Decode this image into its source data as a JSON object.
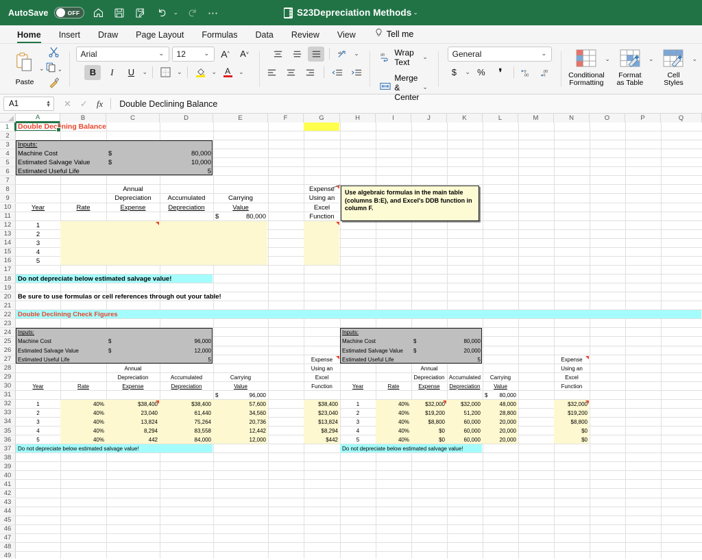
{
  "titlebar": {
    "autosave_label": "AutoSave",
    "autosave_state": "OFF",
    "document_title": "S23Depreciation Methods",
    "icons": [
      "home-icon",
      "save-icon",
      "save-as-icon",
      "undo-icon",
      "redo-icon",
      "more-icon"
    ]
  },
  "tabs": [
    {
      "label": "Home",
      "active": true
    },
    {
      "label": "Insert",
      "active": false
    },
    {
      "label": "Draw",
      "active": false
    },
    {
      "label": "Page Layout",
      "active": false
    },
    {
      "label": "Formulas",
      "active": false
    },
    {
      "label": "Data",
      "active": false
    },
    {
      "label": "Review",
      "active": false
    },
    {
      "label": "View",
      "active": false
    }
  ],
  "tell_me": "Tell me",
  "ribbon": {
    "paste_label": "Paste",
    "font_name": "Arial",
    "font_size": "12",
    "bold": "B",
    "italic": "I",
    "underline": "U",
    "wrap_text": "Wrap Text",
    "merge_center": "Merge & Center",
    "number_format": "General",
    "conditional_formatting": "Conditional\nFormatting",
    "conditional_formatting_l1": "Conditional",
    "conditional_formatting_l2": "Formatting",
    "format_as_table_l1": "Format",
    "format_as_table_l2": "as Table",
    "cell_styles_l1": "Cell",
    "cell_styles_l2": "Styles",
    "percent": "%",
    "comma": "❛",
    "currency": "$"
  },
  "formula_bar": {
    "name_box": "A1",
    "content": "Double Declining Balance",
    "cancel_icon": "cancel-icon",
    "confirm_icon": "confirm-icon",
    "fx_icon": "fx-icon"
  },
  "grid": {
    "columns": [
      "A",
      "B",
      "C",
      "D",
      "E",
      "F",
      "G",
      "H",
      "I",
      "J",
      "K",
      "L",
      "M",
      "N",
      "O",
      "P",
      "Q"
    ],
    "selected_column": "A",
    "selected_row": 1,
    "first_row": 1,
    "last_row": 49
  },
  "comment": {
    "text": "Use algebraic formulas in the main table (columns B:E), and Excel's DDB function in column F."
  },
  "main_table": {
    "title": "Double Declining Balance",
    "inputs_label": "Inputs:",
    "machine_cost_label": "Machine Cost",
    "machine_cost_sym": "$",
    "machine_cost_value": "80,000",
    "salvage_label": "Estimated Salvage Value",
    "salvage_sym": "$",
    "salvage_value": "10,000",
    "life_label": "Estimated Useful Life",
    "life_value": "5",
    "headers": {
      "year": "Year",
      "rate": "Rate",
      "annual": "Annual",
      "depreciation": "Depreciation",
      "expense": "Expense",
      "accumulated": "Accumulated",
      "accum_depreciation": "Depreciation",
      "carrying": "Carrying",
      "value": "Value",
      "fn_l1": "Expense",
      "fn_l2": "Using an",
      "fn_l3": "Excel",
      "fn_l4": "Function"
    },
    "start_sym": "$",
    "start_value": "80,000",
    "years": [
      "1",
      "2",
      "3",
      "4",
      "5"
    ],
    "note_salvage": "Do not depreciate below estimated salvage value!",
    "note_formulas": "Be sure to use formulas or cell references through out your table!"
  },
  "check_banner": "Double Declining Check Figures",
  "check_left": {
    "inputs_label": "Inputs:",
    "machine_cost_label": "Machine Cost",
    "machine_cost_sym": "$",
    "machine_cost_value": "96,000",
    "salvage_label": "Estimated Salvage Value",
    "salvage_sym": "$",
    "salvage_value": "12,000",
    "life_label": "Estimated Useful Life",
    "life_value": "5",
    "headers": {
      "year": "Year",
      "rate": "Rate",
      "annual": "Annual",
      "depreciation": "Depreciation",
      "expense": "Expense",
      "accumulated": "Accumulated",
      "accum_depreciation": "Depreciation",
      "carrying": "Carrying",
      "value": "Value",
      "fn_l1": "Expense",
      "fn_l2": "Using an",
      "fn_l3": "Excel",
      "fn_l4": "Function"
    },
    "start_sym": "$",
    "start_value": "96,000",
    "rows": [
      {
        "year": "1",
        "rate": "40%",
        "expense": "$38,400",
        "accumulated": "$38,400",
        "carrying": "57,600",
        "fn": "$38,400"
      },
      {
        "year": "2",
        "rate": "40%",
        "expense": "23,040",
        "accumulated": "61,440",
        "carrying": "34,560",
        "fn": "$23,040"
      },
      {
        "year": "3",
        "rate": "40%",
        "expense": "13,824",
        "accumulated": "75,264",
        "carrying": "20,736",
        "fn": "$13,824"
      },
      {
        "year": "4",
        "rate": "40%",
        "expense": "8,294",
        "accumulated": "83,558",
        "carrying": "12,442",
        "fn": "$8,294"
      },
      {
        "year": "5",
        "rate": "40%",
        "expense": "442",
        "accumulated": "84,000",
        "carrying": "12,000",
        "fn": "$442"
      }
    ],
    "note_salvage": "Do not depreciate below estimated salvage value!"
  },
  "check_right": {
    "inputs_label": "Inputs:",
    "machine_cost_label": "Machine Cost",
    "machine_cost_sym": "$",
    "machine_cost_value": "80,000",
    "salvage_label": "Estimated Salvage Value",
    "salvage_sym": "$",
    "salvage_value": "20,000",
    "life_label": "Estimated Useful Life",
    "life_value": "5",
    "headers": {
      "year": "Year",
      "rate": "Rate",
      "annual": "Annual",
      "depreciation": "Depreciation",
      "expense": "Expense",
      "accumulated": "Accumulated",
      "accum_depreciation": "Depreciation",
      "carrying": "Carrying",
      "value": "Value",
      "fn_l1": "Expense",
      "fn_l2": "Using an",
      "fn_l3": "Excel",
      "fn_l4": "Function"
    },
    "start_sym": "$",
    "start_value": "80,000",
    "rows": [
      {
        "year": "1",
        "rate": "40%",
        "expense": "$32,000",
        "accumulated": "$32,000",
        "carrying": "48,000",
        "fn": "$32,000"
      },
      {
        "year": "2",
        "rate": "40%",
        "expense": "$19,200",
        "accumulated": "51,200",
        "carrying": "28,800",
        "fn": "$19,200"
      },
      {
        "year": "3",
        "rate": "40%",
        "expense": "$8,800",
        "accumulated": "60,000",
        "carrying": "20,000",
        "fn": "$8,800"
      },
      {
        "year": "4",
        "rate": "40%",
        "expense": "$0",
        "accumulated": "60,000",
        "carrying": "20,000",
        "fn": "$0"
      },
      {
        "year": "5",
        "rate": "40%",
        "expense": "$0",
        "accumulated": "60,000",
        "carrying": "20,000",
        "fn": "$0"
      }
    ],
    "note_salvage": "Do not depreciate below estimated salvage value!"
  },
  "colors": {
    "excel_green": "#217346",
    "title_red": "#e8452c",
    "input_gray": "#bfbfbf",
    "fill_yellow": "#fdf8d0",
    "fill_cyan": "#a5fcfc",
    "highlight_yellow": "#ffff4d"
  }
}
